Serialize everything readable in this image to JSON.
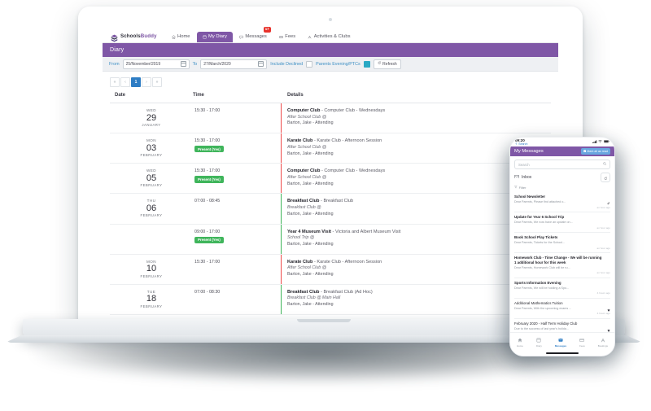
{
  "desktop": {
    "brand": {
      "name_a": "Schools",
      "name_b": "Buddy"
    },
    "nav": [
      {
        "label": "Home",
        "icon": "home-icon",
        "active": false,
        "badge": ""
      },
      {
        "label": "My Diary",
        "icon": "diary-icon",
        "active": true,
        "badge": ""
      },
      {
        "label": "Messages",
        "icon": "messages-icon",
        "active": false,
        "badge": "17"
      },
      {
        "label": "Fees",
        "icon": "fees-icon",
        "active": false,
        "badge": ""
      },
      {
        "label": "Activities & Clubs",
        "icon": "activities-icon",
        "active": false,
        "badge": ""
      }
    ],
    "page_title": "Diary",
    "filters": {
      "from_label": "From",
      "from_value": "25/November/2019",
      "to_label": "To",
      "to_value": "27/March/2020",
      "include_declined_label": "Include Declined",
      "include_declined_checked": false,
      "parents_evening_label": "Parents Evening/PTCs",
      "parents_evening_checked": true,
      "refresh_label": "Refresh"
    },
    "pagination": {
      "pages": [
        "«",
        "‹",
        "1",
        "›",
        "»"
      ],
      "active_index": 2
    },
    "table": {
      "headers": [
        "Date",
        "Time",
        "Details"
      ],
      "rows": [
        {
          "weekday": "WED",
          "day": "29",
          "month": "JANUARY",
          "time": "15:30 - 17:00",
          "present": "",
          "title_bold": "Computer Club",
          "title_rest": " - Computer Club - Wednesdays",
          "line2": "After School Club @",
          "line3": "Barton, Jake - Attending",
          "marker": "#ef4a4a"
        },
        {
          "weekday": "MON",
          "day": "03",
          "month": "FEBRUARY",
          "time": "15:30 - 17:00",
          "present": "Present (Yes)",
          "title_bold": "Karate Club",
          "title_rest": " - Karate Club - Afternoon Session",
          "line2": "After School Club @",
          "line3": "Barton, Jake - Attending",
          "marker": "#ef4a4a"
        },
        {
          "weekday": "WED",
          "day": "05",
          "month": "FEBRUARY",
          "time": "15:30 - 17:00",
          "present": "Present (Yes)",
          "title_bold": "Computer Club",
          "title_rest": " - Computer Club - Wednesdays",
          "line2": "After School Club @",
          "line3": "Barton, Jake - Attending",
          "marker": "#ef4a4a"
        },
        {
          "weekday": "THU",
          "day": "06",
          "month": "FEBRUARY",
          "time": "07:00 - 08:45",
          "present": "",
          "title_bold": "Breakfast Club",
          "title_rest": " - Breakfast Club",
          "line2": "Breakfast Club @",
          "line3": "Barton, Jake - Attending",
          "marker": "#3fb55b"
        },
        {
          "weekday": "",
          "day": "",
          "month": "",
          "time": "09:00 - 17:00",
          "present": "Present (Yes)",
          "title_bold": "Year 4 Museum Visit",
          "title_rest": " - Victoria and Albert Museum Visit",
          "line2": "School Trip @",
          "line3": "Barton, Jake - Attending",
          "marker": "#3fb55b"
        },
        {
          "weekday": "MON",
          "day": "10",
          "month": "FEBRUARY",
          "time": "15:30 - 17:00",
          "present": "",
          "title_bold": "Karate Club",
          "title_rest": " - Karate Club - Afternoon Session",
          "line2": "After School Club @",
          "line3": "Barton, Jake - Attending",
          "marker": "#ef4a4a"
        },
        {
          "weekday": "TUE",
          "day": "18",
          "month": "FEBRUARY",
          "time": "07:00 - 08:30",
          "present": "",
          "title_bold": "Breakfast Club",
          "title_rest": " - Breakfast Club (Ad Hoc)",
          "line2": "Breakfast Club @ Main Hall",
          "line3": "Barton, Jake - Attending",
          "marker": "#3fb55b"
        }
      ]
    }
  },
  "phone": {
    "status": {
      "time": "09:20",
      "carrier_note": "Search"
    },
    "header": {
      "title": "My Messages",
      "mark_all_label": "Mark all as read"
    },
    "search_placeholder": "Search",
    "folder": {
      "label": "Inbox",
      "refresh_icon": "refresh-icon"
    },
    "filter_label": "Filter",
    "messages": [
      {
        "title": "School Newsletter",
        "preview": "Dear Parents,  Please find attached o...",
        "time": "an hour ago",
        "unread": true,
        "icon": "attachment-icon"
      },
      {
        "title": "Update for Year 6 School Trip",
        "preview": "Dear Parents, We now have an update on...",
        "time": "an hour ago",
        "unread": true,
        "icon": ""
      },
      {
        "title": "Book School Play Tickets",
        "preview": "Dear Parents,  Tickets for the School...",
        "time": "an hour ago",
        "unread": true,
        "icon": ""
      },
      {
        "title": "Homework Club - Time Change - We will be running 1 additional hour for this week",
        "preview": "Dear Parents, Homework Club will be ru...",
        "time": "an hour ago",
        "unread": true,
        "icon": ""
      },
      {
        "title": "Sports Information Evening",
        "preview": "Dear Parents, We will be holding a Spo...",
        "time": "4 hours ago",
        "unread": true,
        "icon": ""
      },
      {
        "title": "Additional Mathematics Tuition",
        "preview": "Dear Parents, With the upcoming exams ...",
        "time": "4 hours ago",
        "unread": false,
        "icon": "star-icon"
      },
      {
        "title": "February 2020 - Half Term Holiday Club",
        "preview": "Due to the success of last year's holida...",
        "time": "",
        "unread": false,
        "icon": "star-icon"
      }
    ],
    "nav": [
      {
        "label": "Home",
        "icon": "home-icon",
        "active": false
      },
      {
        "label": "Diary",
        "icon": "diary-icon",
        "active": false
      },
      {
        "label": "Messages",
        "icon": "messages-icon",
        "active": true
      },
      {
        "label": "Fees",
        "icon": "fees-icon",
        "active": false
      },
      {
        "label": "Bookings",
        "icon": "bookings-icon",
        "active": false
      }
    ]
  },
  "colors": {
    "brand_purple": "#7f57a6",
    "accent_blue": "#2e7dc4",
    "green": "#3fb55b",
    "red": "#ef4a4a"
  }
}
